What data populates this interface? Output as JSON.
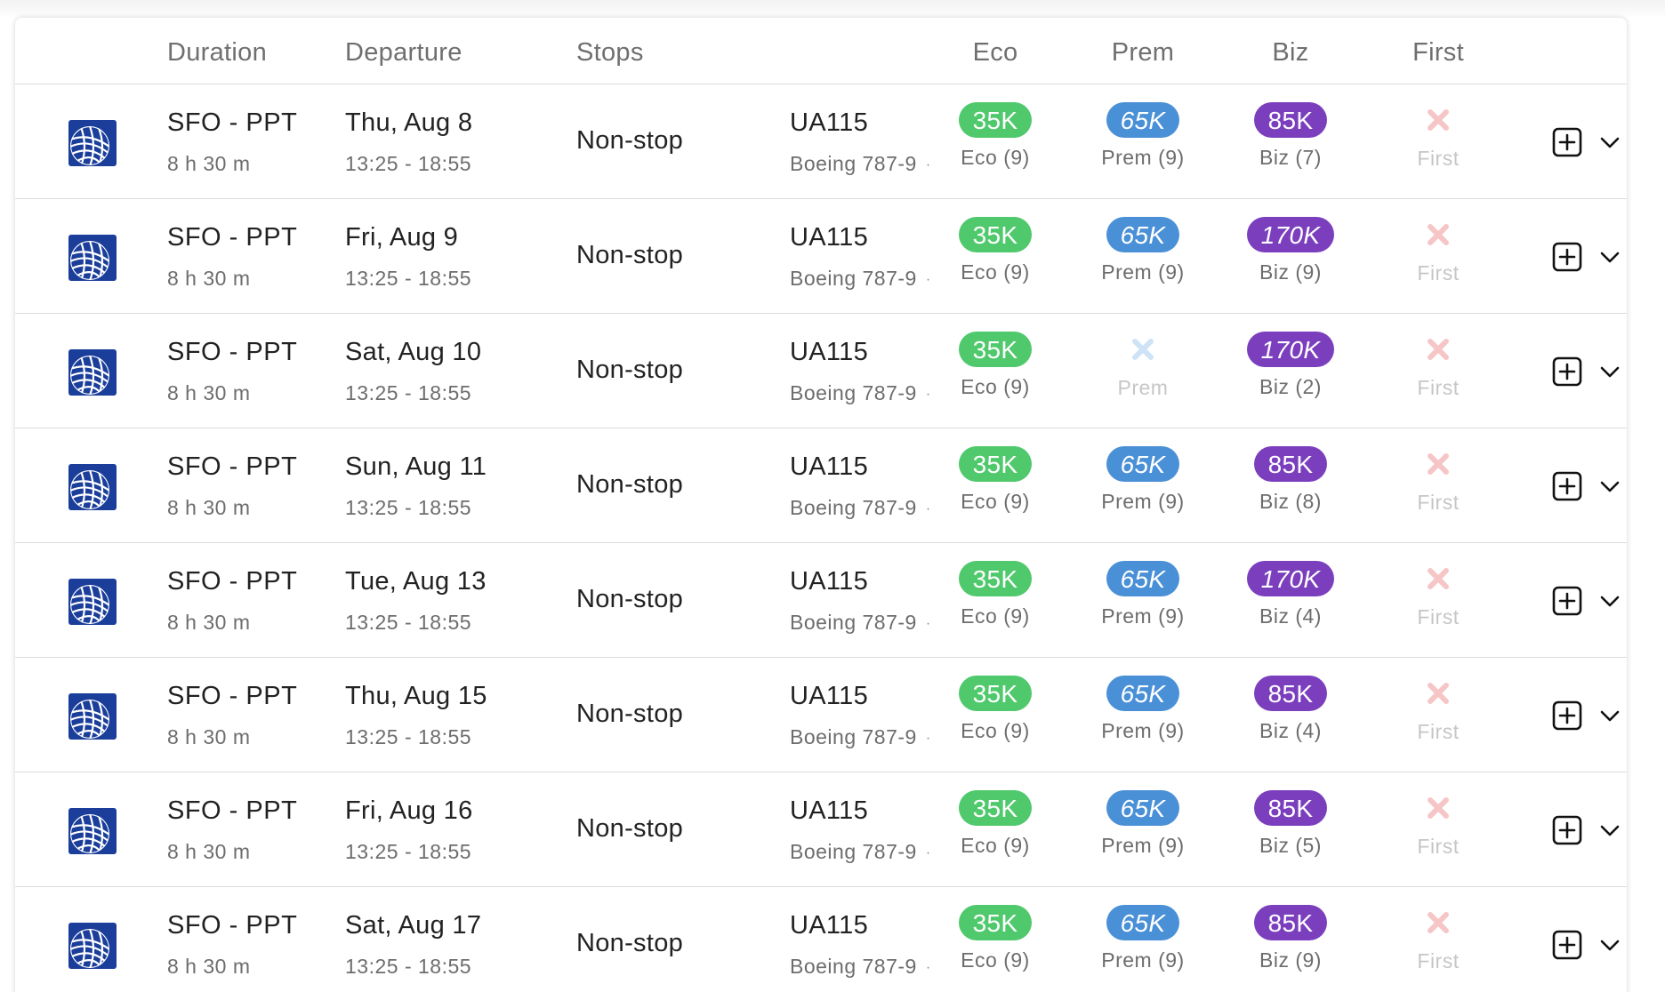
{
  "header": {
    "duration": "Duration",
    "departure": "Departure",
    "stops": "Stops",
    "eco": "Eco",
    "prem": "Prem",
    "biz": "Biz",
    "first": "First"
  },
  "colors": {
    "eco": "#4fc96c",
    "prem": "#4a90d6",
    "biz": "#7b3fbe",
    "unavailable_x": "#f6c6c6",
    "unavailable_prem_x": "#cfe3f6",
    "airline_logo": "#1b3e9b"
  },
  "icons": {
    "airline": "united-globe-icon",
    "add": "plus-square-icon",
    "expand": "chevron-down-icon",
    "unavailable": "x-mark-icon"
  },
  "rows": [
    {
      "route": "SFO - PPT",
      "duration": "8 h 30 m",
      "date": "Thu, Aug 8",
      "time": "13:25 - 18:55",
      "stops": "Non-stop",
      "flight": "UA115",
      "aircraft": "Boeing 787-9",
      "eco": {
        "price": "35K",
        "seats": "Eco (9)"
      },
      "prem": {
        "price": "65K",
        "seats": "Prem (9)",
        "available": true
      },
      "biz": {
        "price": "85K",
        "seats": "Biz (7)",
        "italic": false
      },
      "first": {
        "label": "First",
        "available": false
      }
    },
    {
      "route": "SFO - PPT",
      "duration": "8 h 30 m",
      "date": "Fri, Aug 9",
      "time": "13:25 - 18:55",
      "stops": "Non-stop",
      "flight": "UA115",
      "aircraft": "Boeing 787-9",
      "eco": {
        "price": "35K",
        "seats": "Eco (9)"
      },
      "prem": {
        "price": "65K",
        "seats": "Prem (9)",
        "available": true
      },
      "biz": {
        "price": "170K",
        "seats": "Biz (9)",
        "italic": true
      },
      "first": {
        "label": "First",
        "available": false
      }
    },
    {
      "route": "SFO - PPT",
      "duration": "8 h 30 m",
      "date": "Sat, Aug 10",
      "time": "13:25 - 18:55",
      "stops": "Non-stop",
      "flight": "UA115",
      "aircraft": "Boeing 787-9",
      "eco": {
        "price": "35K",
        "seats": "Eco (9)"
      },
      "prem": {
        "price": "",
        "seats": "Prem",
        "available": false
      },
      "biz": {
        "price": "170K",
        "seats": "Biz (2)",
        "italic": true
      },
      "first": {
        "label": "First",
        "available": false
      }
    },
    {
      "route": "SFO - PPT",
      "duration": "8 h 30 m",
      "date": "Sun, Aug 11",
      "time": "13:25 - 18:55",
      "stops": "Non-stop",
      "flight": "UA115",
      "aircraft": "Boeing 787-9",
      "eco": {
        "price": "35K",
        "seats": "Eco (9)"
      },
      "prem": {
        "price": "65K",
        "seats": "Prem (9)",
        "available": true
      },
      "biz": {
        "price": "85K",
        "seats": "Biz (8)",
        "italic": false
      },
      "first": {
        "label": "First",
        "available": false
      }
    },
    {
      "route": "SFO - PPT",
      "duration": "8 h 30 m",
      "date": "Tue, Aug 13",
      "time": "13:25 - 18:55",
      "stops": "Non-stop",
      "flight": "UA115",
      "aircraft": "Boeing 787-9",
      "eco": {
        "price": "35K",
        "seats": "Eco (9)"
      },
      "prem": {
        "price": "65K",
        "seats": "Prem (9)",
        "available": true
      },
      "biz": {
        "price": "170K",
        "seats": "Biz (4)",
        "italic": true
      },
      "first": {
        "label": "First",
        "available": false
      }
    },
    {
      "route": "SFO - PPT",
      "duration": "8 h 30 m",
      "date": "Thu, Aug 15",
      "time": "13:25 - 18:55",
      "stops": "Non-stop",
      "flight": "UA115",
      "aircraft": "Boeing 787-9",
      "eco": {
        "price": "35K",
        "seats": "Eco (9)"
      },
      "prem": {
        "price": "65K",
        "seats": "Prem (9)",
        "available": true
      },
      "biz": {
        "price": "85K",
        "seats": "Biz (4)",
        "italic": false
      },
      "first": {
        "label": "First",
        "available": false
      }
    },
    {
      "route": "SFO - PPT",
      "duration": "8 h 30 m",
      "date": "Fri, Aug 16",
      "time": "13:25 - 18:55",
      "stops": "Non-stop",
      "flight": "UA115",
      "aircraft": "Boeing 787-9",
      "eco": {
        "price": "35K",
        "seats": "Eco (9)"
      },
      "prem": {
        "price": "65K",
        "seats": "Prem (9)",
        "available": true
      },
      "biz": {
        "price": "85K",
        "seats": "Biz (5)",
        "italic": false
      },
      "first": {
        "label": "First",
        "available": false
      }
    },
    {
      "route": "SFO - PPT",
      "duration": "8 h 30 m",
      "date": "Sat, Aug 17",
      "time": "13:25 - 18:55",
      "stops": "Non-stop",
      "flight": "UA115",
      "aircraft": "Boeing 787-9",
      "eco": {
        "price": "35K",
        "seats": "Eco (9)"
      },
      "prem": {
        "price": "65K",
        "seats": "Prem (9)",
        "available": true
      },
      "biz": {
        "price": "85K",
        "seats": "Biz (9)",
        "italic": false
      },
      "first": {
        "label": "First",
        "available": false
      }
    }
  ]
}
